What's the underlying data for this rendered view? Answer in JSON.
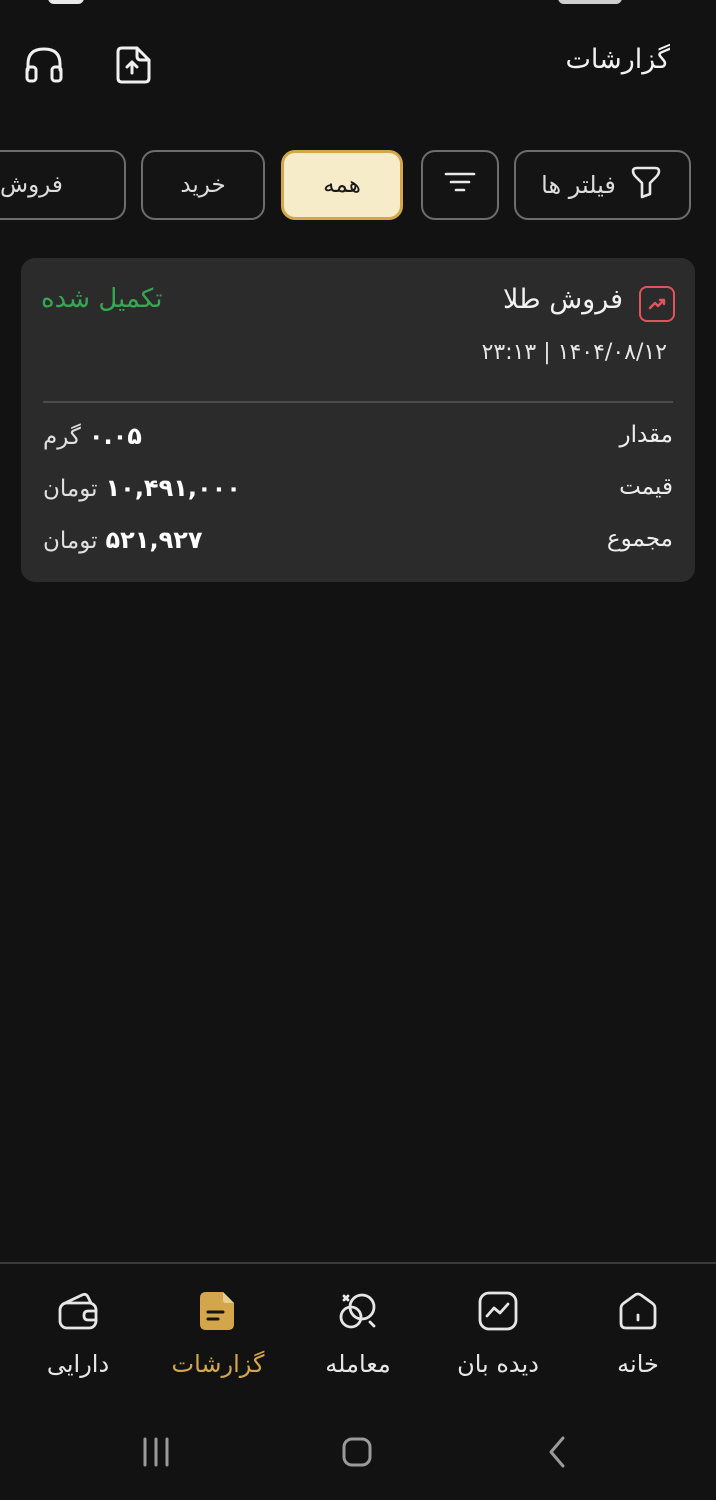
{
  "header": {
    "title": "گزارشات",
    "icons": [
      "support-headset-icon",
      "upload-report-icon"
    ]
  },
  "filters": {
    "filters_label": "فیلتر ها",
    "all_label": "همه",
    "buy_label": "خرید",
    "sell_label": "فروش",
    "active": "همه"
  },
  "transaction": {
    "title": "فروش طلا",
    "status": "تکمیل شده",
    "datetime": "۲۳:۱۳ | ۱۴۰۴/۰۸/۱۲",
    "rows": [
      {
        "label": "مقدار",
        "value": "۰.۰۵",
        "unit": "گرم"
      },
      {
        "label": "قیمت",
        "value": "۱۰,۴۹۱,۰۰۰",
        "unit": "تومان"
      },
      {
        "label": "مجموع",
        "value": "۵۲۱,۹۲۷",
        "unit": "تومان"
      }
    ]
  },
  "nav": {
    "home": "خانه",
    "watch": "دیده بان",
    "trade": "معامله",
    "reports": "گزارشات",
    "assets": "دارایی",
    "active": "گزارشات"
  },
  "colors": {
    "background": "#121212",
    "card": "#2b2b2b",
    "accent_gold": "#d3a64b",
    "chip_active_bg": "#f7ecc9",
    "status_green": "#34a853",
    "sell_red": "#e0545e"
  }
}
